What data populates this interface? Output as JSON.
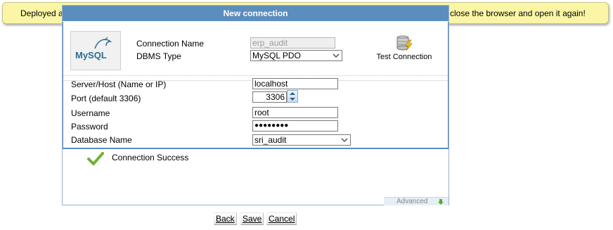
{
  "notice": {
    "left_text": "Deployed a",
    "right_text": "close the browser and open it again!"
  },
  "dialog": {
    "title": "New connection",
    "logo_icon": "mysql-logo",
    "logo_text_main": "MySQL",
    "connection_name_label": "Connection Name",
    "connection_name_value": "erp_audit",
    "dbms_type_label": "DBMS Type",
    "dbms_type_value": "MySQL PDO",
    "test_connection_label": "Test Connection",
    "test_connection_icon": "database-lightning-icon",
    "fields": {
      "host_label": "Server/Host (Name or IP)",
      "host_value": "localhost",
      "port_label": "Port (default 3306)",
      "port_value": "3306",
      "username_label": "Username",
      "username_value": "root",
      "password_label": "Password",
      "password_value": "●●●●●●●●",
      "database_label": "Database Name",
      "database_value": "sri_audit"
    },
    "status_text": "Connection Success",
    "status_icon": "checkmark-icon",
    "advanced_label": "Advanced",
    "advanced_icon": "arrow-down-icon"
  },
  "buttons": {
    "back": "Back",
    "save": "Save",
    "cancel": "Cancel"
  },
  "colors": {
    "title_bar": "#5b8dbf",
    "notice_bg": "#fbf6a6",
    "success_green": "#6fb12f"
  }
}
